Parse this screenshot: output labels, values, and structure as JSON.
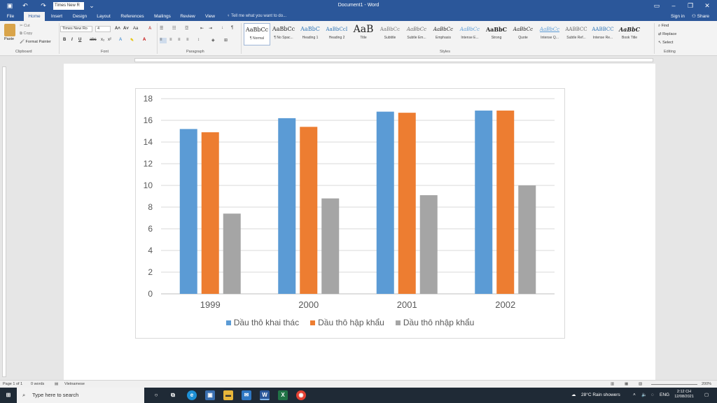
{
  "titlebar": {
    "title": "Document1 - Word",
    "font_box": "Times New R",
    "save_icon": "save-icon",
    "undo_icon": "undo-icon"
  },
  "tabs": [
    {
      "label": "File"
    },
    {
      "label": "Home"
    },
    {
      "label": "Insert"
    },
    {
      "label": "Design"
    },
    {
      "label": "Layout"
    },
    {
      "label": "References"
    },
    {
      "label": "Mailings"
    },
    {
      "label": "Review"
    },
    {
      "label": "View"
    }
  ],
  "tell_me": "Tell me what you want to do...",
  "sign_in": "Sign in",
  "share": "Share",
  "clipboard": {
    "paste": "Paste",
    "cut": "Cut",
    "copy": "Copy",
    "format_painter": "Format Painter",
    "group_label": "Clipboard"
  },
  "font": {
    "family": "Times New Ro",
    "size": "4",
    "group_label": "Font",
    "bold": "B",
    "italic": "I",
    "underline": "U",
    "strike": "abc",
    "sub": "x₂",
    "sup": "x²",
    "grow": "A˄",
    "shrink": "A˅",
    "case": "Aa",
    "clear": "A"
  },
  "paragraph": {
    "group_label": "Paragraph"
  },
  "styles": {
    "group_label": "Styles",
    "items": [
      {
        "preview": "AaBbCc",
        "name": "¶ Normal"
      },
      {
        "preview": "AaBbCc",
        "name": "¶ No Spac..."
      },
      {
        "preview": "AaBbC",
        "name": "Heading 1"
      },
      {
        "preview": "AaBbCcI",
        "name": "Heading 2"
      },
      {
        "preview": "AaB",
        "name": "Title"
      },
      {
        "preview": "AaBbCc",
        "name": "Subtitle"
      },
      {
        "preview": "AaBbCc",
        "name": "Subtle Em..."
      },
      {
        "preview": "AaBbCc",
        "name": "Emphasis"
      },
      {
        "preview": "AaBbCc",
        "name": "Intense E..."
      },
      {
        "preview": "AaBbC",
        "name": "Strong"
      },
      {
        "preview": "AaBbCc",
        "name": "Quote"
      },
      {
        "preview": "AaBbCc",
        "name": "Intense Q..."
      },
      {
        "preview": "AABBCC",
        "name": "Subtle Ref..."
      },
      {
        "preview": "AABBCC",
        "name": "Intense Re..."
      },
      {
        "preview": "AaBbC",
        "name": "Book Title"
      }
    ]
  },
  "editing": {
    "find": "Find",
    "replace": "Replace",
    "select": "Select",
    "group_label": "Editing"
  },
  "chart_data": {
    "type": "bar",
    "categories": [
      "1999",
      "2000",
      "2001",
      "2002"
    ],
    "series": [
      {
        "name": "Dầu thô khai thác",
        "values": [
          15.2,
          16.2,
          16.8,
          16.9
        ],
        "color": "#5b9bd5"
      },
      {
        "name": "Dầu thô hập khẩu",
        "values": [
          14.9,
          15.4,
          16.7,
          16.9
        ],
        "color": "#ed7d31"
      },
      {
        "name": "Dầu thô nhập khẩu",
        "values": [
          7.4,
          8.8,
          9.1,
          10.0
        ],
        "color": "#a5a5a5"
      }
    ],
    "yticks": [
      "0",
      "2",
      "4",
      "6",
      "8",
      "10",
      "12",
      "14",
      "16",
      "18"
    ],
    "ylim": [
      0,
      18
    ],
    "grid": true,
    "legend_position": "bottom"
  },
  "status": {
    "page": "Page 1 of 1",
    "words": "0 words",
    "language": "Vietnamese",
    "zoom": "200%"
  },
  "taskbar": {
    "search_placeholder": "Type here to search",
    "weather": "28°C  Rain showers",
    "lang": "ENG",
    "time": "2:12 CH",
    "date": "12/08/2021"
  }
}
